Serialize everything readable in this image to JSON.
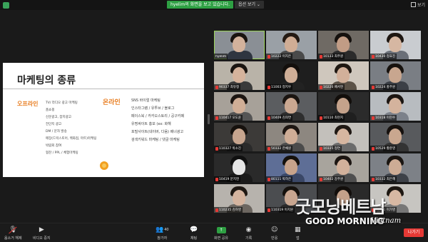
{
  "topbar": {
    "share_banner": "hyelim의 화면을 보고 있습니다.",
    "view_options": "옵션 보기 ⌄",
    "view_label": "보기"
  },
  "slide": {
    "title": "마케팅의 종류",
    "offline_label": "오프라인",
    "offline_items": [
      "TV/ 라디오 광고 마케팅",
      "홈쇼핑",
      "신문광고, 잡지광고",
      "전단지 광고",
      "DM / 문자 발송",
      "매장(드럭스토어, 백화점, 마트)마케팅",
      "박람회 참여",
      "협찬 / PPL / 체험마케팅"
    ],
    "online_label": "온라인",
    "online_items": [
      "SNS 바이럴 마케팅",
      "인스타그램 / 유투브 / 블로그",
      "페이스북 / 카카오스토리 / 공구카페",
      "유명싸이트 홍보 (ex: 화해",
      "포털사이트(네이버, 다음) 배너광고",
      "검색키워드 마케팅 / 댓글 마케팅"
    ]
  },
  "participants": [
    {
      "name": "hyelim",
      "muted": false,
      "bg": "#8a8f95",
      "skin": "#d3b29c",
      "hair": "#1a1410",
      "shirt": "#2f3540",
      "active": true
    },
    {
      "name": "10222 이지은",
      "muted": true,
      "bg": "#9aa0a6",
      "skin": "#d0ad95",
      "hair": "#241a14",
      "shirt": "#4a4a4a"
    },
    {
      "name": "10133 최주원",
      "muted": true,
      "bg": "#6f6a64",
      "skin": "#c19c85",
      "hair": "#15110e",
      "shirt": "#2b2b2b"
    },
    {
      "name": "10430 정효진",
      "muted": true,
      "bg": "#c9ccd0",
      "skin": "#d6b7a2",
      "hair": "#1e1712",
      "shirt": "#6a6f78"
    },
    {
      "name": "90337 최유정",
      "muted": true,
      "bg": "#b9b3a8",
      "skin": "#d5b39c",
      "hair": "#1a1511",
      "shirt": "#3a3a3a"
    },
    {
      "name": "11003 정지우",
      "muted": true,
      "bg": "#1e1e1e",
      "skin": "#cfae97",
      "hair": "#130f0c",
      "shirt": "#222222"
    },
    {
      "name": "10220 배서현",
      "muted": true,
      "bg": "#cfc7bd",
      "skin": "#d2b09a",
      "hair": "#1f1812",
      "shirt": "#5c5247"
    },
    {
      "name": "10224 홍주원",
      "muted": true,
      "bg": "#7a7e84",
      "skin": "#c8a68f",
      "hair": "#17120e",
      "shirt": "#3b3f46"
    },
    {
      "name": "110417 오도윤",
      "muted": true,
      "bg": "#a7a199",
      "skin": "#d0ae96",
      "hair": "#1c1511",
      "shirt": "#555555"
    },
    {
      "name": "10409 김희연",
      "muted": true,
      "bg": "#5b5d60",
      "skin": "#cba891",
      "hair": "#1a1410",
      "shirt": "#2e2e2e"
    },
    {
      "name": "10110 최현지",
      "muted": true,
      "bg": "#2b2b2b",
      "skin": "#c4a28b",
      "hair": "#120e0b",
      "shirt": "#1f1f1f"
    },
    {
      "name": "10318 이현수",
      "muted": true,
      "bg": "#b8bcc0",
      "skin": "#d4b39d",
      "hair": "#1b1511",
      "shirt": "#7c818a"
    },
    {
      "name": "110327 박소진",
      "muted": true,
      "bg": "#3c3a38",
      "skin": "#c7a58e",
      "hair": "#16110d",
      "shirt": "#2a2a2a"
    },
    {
      "name": "50332 한채원",
      "muted": true,
      "bg": "#8d8780",
      "skin": "#cfad96",
      "hair": "#1d1612",
      "shirt": "#4b4b4b"
    },
    {
      "name": "10335 정연",
      "muted": true,
      "bg": "#c3c0bb",
      "skin": "#d6b6a0",
      "hair": "#1f1813",
      "shirt": "#6b6b6b"
    },
    {
      "name": "10529 황준영",
      "muted": true,
      "bg": "#585a5d",
      "skin": "#c9a78f",
      "hair": "#16110e",
      "shirt": "#333333"
    },
    {
      "name": "10419 문지현",
      "muted": true,
      "bg": "#2a2a2a",
      "skin": "#e6e6e6",
      "hair": "#101010",
      "shirt": "#1a1a1a"
    },
    {
      "name": "80111 박하은",
      "muted": true,
      "bg": "#5e6e96",
      "skin": "#c7a38b",
      "hair": "#15110d",
      "shirt": "#3a4766"
    },
    {
      "name": "10402 강주원",
      "muted": true,
      "bg": "#a8a49d",
      "skin": "#d2b19b",
      "hair": "#1c1612",
      "shirt": "#4f4f4f"
    },
    {
      "name": "10332 최은혜",
      "muted": true,
      "bg": "#7d8187",
      "skin": "#cdac95",
      "hair": "#1a1511",
      "shirt": "#3d4148"
    },
    {
      "name": "110235 김하영",
      "muted": true,
      "bg": "#b7b3ad",
      "skin": "#d4b49f",
      "hair": "#1e1813",
      "shirt": "#6c6660"
    },
    {
      "name": "110319 이지원",
      "muted": true,
      "bg": "#4b4d50",
      "skin": "#c8a690",
      "hair": "#15110d",
      "shirt": "#2a2a2a"
    },
    {
      "name": "",
      "muted": true,
      "bg": "#2a2a2a",
      "skin": "#c3a18a",
      "hair": "#120e0b",
      "shirt": "#1f1f1f"
    },
    {
      "name": "10421 이가영",
      "muted": true,
      "bg": "#c7c5c1",
      "skin": "#d7b8a3",
      "hair": "#1d1712",
      "shirt": "#777777"
    }
  ],
  "toolbar": {
    "mute_label": "음소거 해제",
    "video_label": "비디오 중지",
    "participants_label": "참가자",
    "participants_count": "40",
    "chat_label": "채팅",
    "share_label": "화면 공유",
    "record_label": "기록",
    "reactions_label": "반응",
    "apps_label": "앱",
    "leave_label": "나가기"
  },
  "watermark": {
    "korean": "굿모닝베트남",
    "english": "GOOD MORNING",
    "script": "Vietnam"
  },
  "colors": {
    "accent_orange": "#e87e22",
    "share_green": "#2ea043",
    "leave_red": "#e53935",
    "active_speaker": "#9bd35a"
  }
}
